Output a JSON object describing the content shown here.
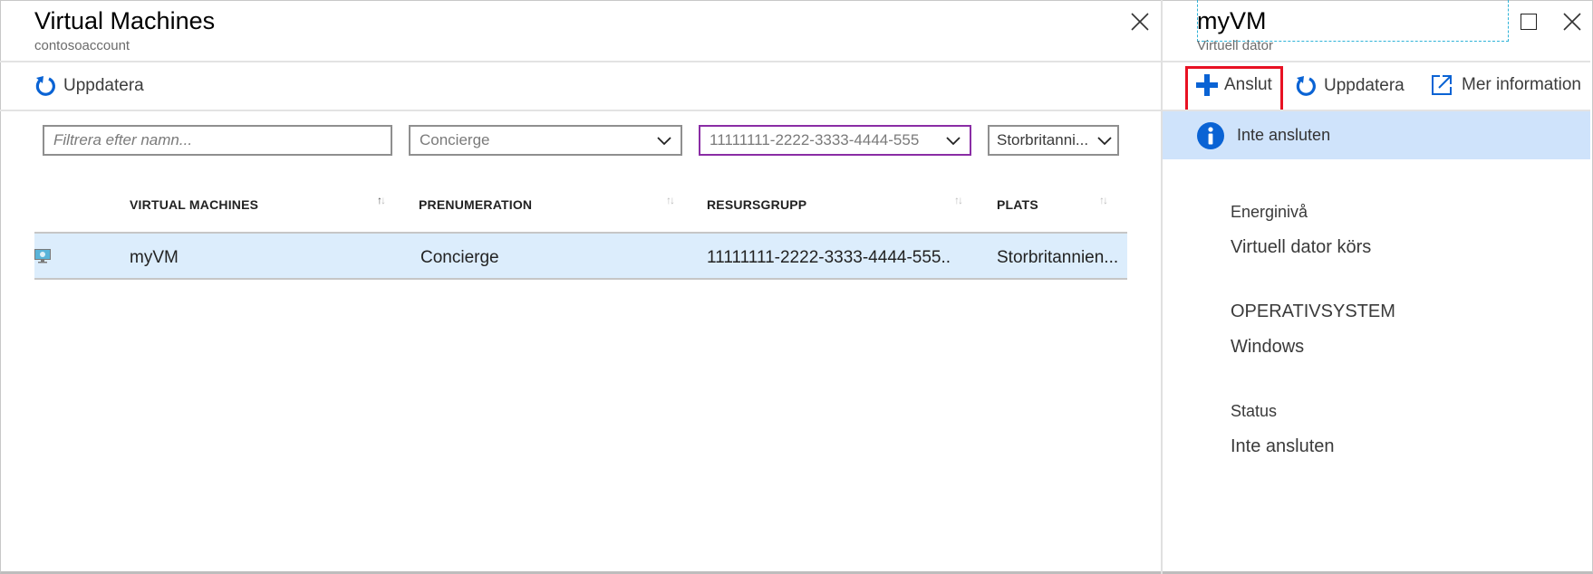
{
  "left_blade": {
    "title": "Virtual Machines",
    "subtitle": "contosoaccount",
    "toolbar": {
      "refresh_label": "Uppdatera"
    },
    "filters": {
      "name_placeholder": "Filtrera efter namn...",
      "subscription": "Concierge",
      "resource_group": "11111111-2222-3333-4444-555",
      "location": "Storbritanni..."
    },
    "table": {
      "columns": [
        "VIRTUAL MACHINES",
        "PRENUMERATION",
        "RESURSGRUPP",
        "PLATS"
      ],
      "active_sort_column": "VIRTUAL MACHINES",
      "rows": [
        {
          "icon": "virtual-machine-icon",
          "name": "myVM",
          "subscription": "Concierge",
          "resource_group": "11111111-2222-3333-4444-555..",
          "location": "Storbritannien...",
          "selected": true
        }
      ]
    }
  },
  "right_blade": {
    "title": "myVM",
    "subtitle": "Virtuell dator",
    "toolbar": {
      "connect_label": "Anslut",
      "refresh_label": "Uppdatera",
      "more_info_label": "Mer information"
    },
    "info_banner": "Inte ansluten",
    "details": [
      {
        "label": "Energinivå",
        "value": "Virtuell dator körs"
      },
      {
        "label": "OPERATIVSYSTEM",
        "value": "Windows"
      },
      {
        "label": "Status",
        "value": "Inte ansluten"
      }
    ]
  },
  "colors": {
    "accent_blue": "#0a63d4",
    "selected_row": "#dcedfc",
    "info_banner": "#cfe3fb",
    "highlight_red": "#e81123",
    "focus_purple": "#8a2da5"
  }
}
